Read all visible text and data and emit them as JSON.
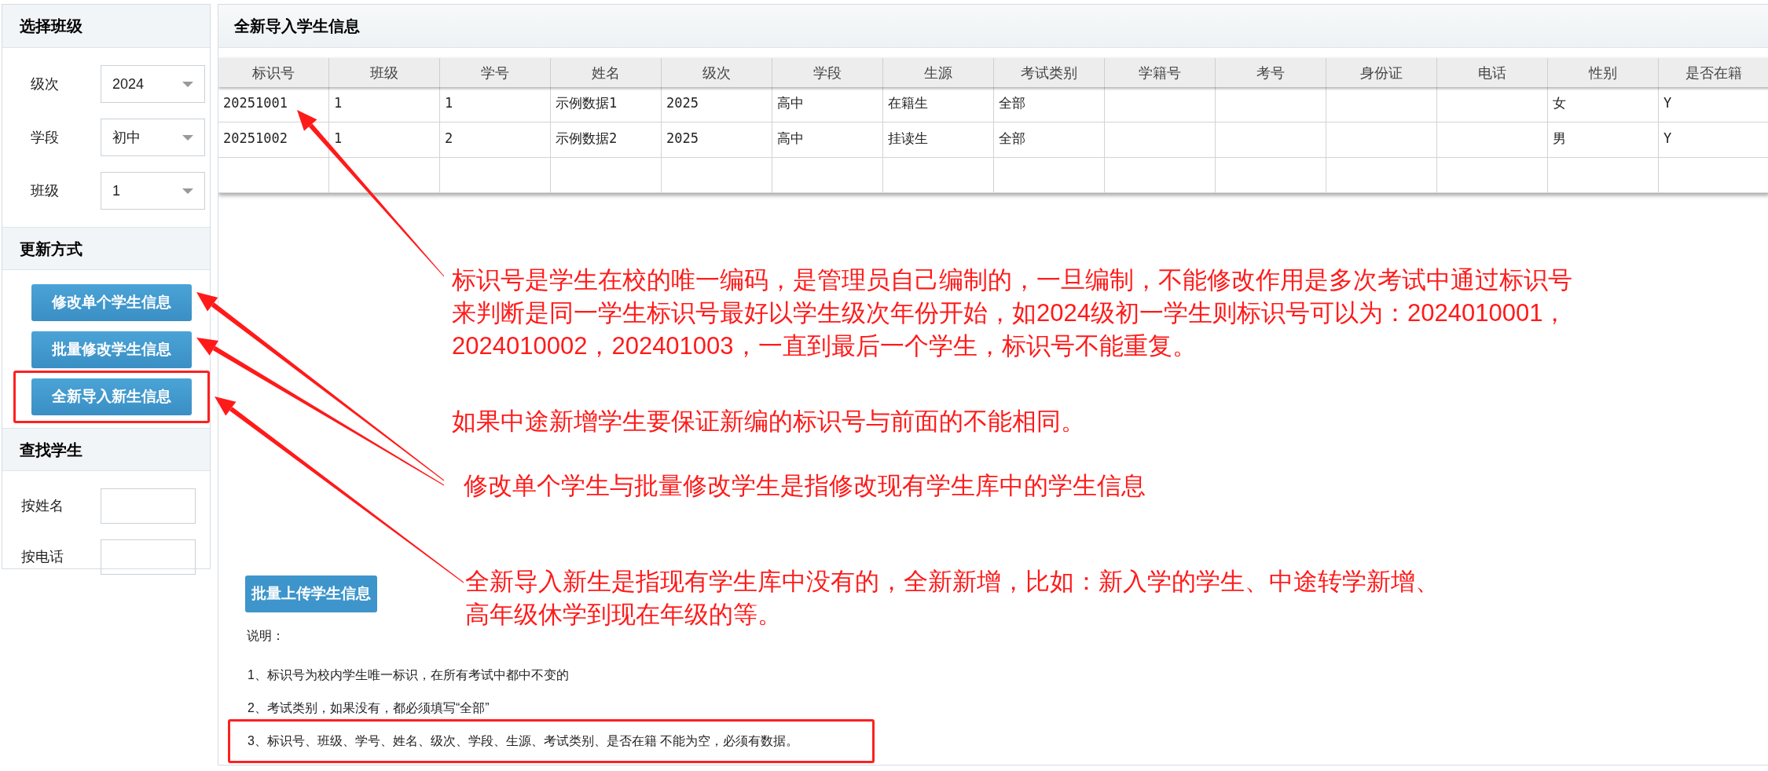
{
  "sidebar": {
    "sections": [
      {
        "title": "选择班级",
        "kind": "selects",
        "fields": [
          {
            "label": "级次",
            "value": "2024"
          },
          {
            "label": "学段",
            "value": "初中"
          },
          {
            "label": "班级",
            "value": "1"
          }
        ]
      },
      {
        "title": "更新方式",
        "kind": "buttons",
        "buttons": [
          {
            "label": "修改单个学生信息",
            "highlighted": false
          },
          {
            "label": "批量修改学生信息",
            "highlighted": false
          },
          {
            "label": "全新导入新生信息",
            "highlighted": true
          }
        ]
      },
      {
        "title": "查找学生",
        "kind": "inputs",
        "fields": [
          {
            "label": "按姓名"
          },
          {
            "label": "按电话"
          }
        ]
      }
    ]
  },
  "main": {
    "title": "全新导入学生信息",
    "table": {
      "columns": [
        "标识号",
        "班级",
        "学号",
        "姓名",
        "级次",
        "学段",
        "生源",
        "考试类别",
        "学籍号",
        "考号",
        "身份证",
        "电话",
        "性别",
        "是否在籍"
      ],
      "rows": [
        [
          "20251001",
          "1",
          "1",
          "示例数据1",
          "2025",
          "高中",
          "在籍生",
          "全部",
          null,
          null,
          null,
          null,
          "女",
          "Y"
        ],
        [
          "20251002",
          "1",
          "2",
          "示例数据2",
          "2025",
          "高中",
          "挂读生",
          "全部",
          null,
          null,
          null,
          null,
          "男",
          "Y"
        ]
      ]
    },
    "upload_button": "批量上传学生信息",
    "notes": {
      "title": "说明：",
      "items": [
        {
          "text": "1、标识号为校内学生唯一标识，在所有考试中都中不变的",
          "highlighted": false
        },
        {
          "text": "2、考试类别，如果没有，都必须填写“全部”",
          "highlighted": false
        },
        {
          "text": "3、标识号、班级、学号、姓名、级次、学段、生源、考试类别、是否在籍 不能为空，必须有数据。",
          "highlighted": true
        }
      ]
    }
  },
  "annotations": [
    {
      "lines": [
        "标识号是学生在校的唯一编码，是管理员自己编制的，一旦编制，不能修改作用是多次考试中通过标识号",
        "来判断是同一学生标识号最好以学生级次年份开始，如2024级初一学生则标识号可以为：2024010001，",
        "2024010002，202401003，一直到最后一个学生，标识号不能重复。"
      ]
    },
    {
      "lines": [
        "如果中途新增学生要保证新编的标识号与前面的不能相同。"
      ]
    },
    {
      "lines": [
        "修改单个学生与批量修改学生是指修改现有学生库中的学生信息"
      ]
    },
    {
      "lines": [
        "全新导入新生是指现有学生库中没有的，全新新增，比如：新入学的学生、中途转学新增、",
        "高年级休学到现在年级的等。"
      ]
    }
  ]
}
